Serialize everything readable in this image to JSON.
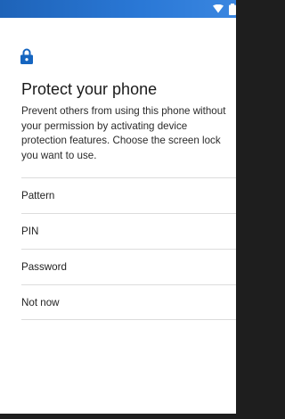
{
  "colors": {
    "status_bar": "#2a78d6",
    "accent": "#1565c0",
    "background": "#ffffff"
  },
  "status_bar": {
    "icons": [
      "wifi-icon",
      "battery-icon"
    ]
  },
  "header": {
    "icon": "lock-icon",
    "title": "Protect your phone",
    "description": "Prevent others from using this phone without your permission by activating device protection features. Choose the screen lock you want to use."
  },
  "options": [
    {
      "label": "Pattern"
    },
    {
      "label": "PIN"
    },
    {
      "label": "Password"
    },
    {
      "label": "Not now"
    }
  ]
}
